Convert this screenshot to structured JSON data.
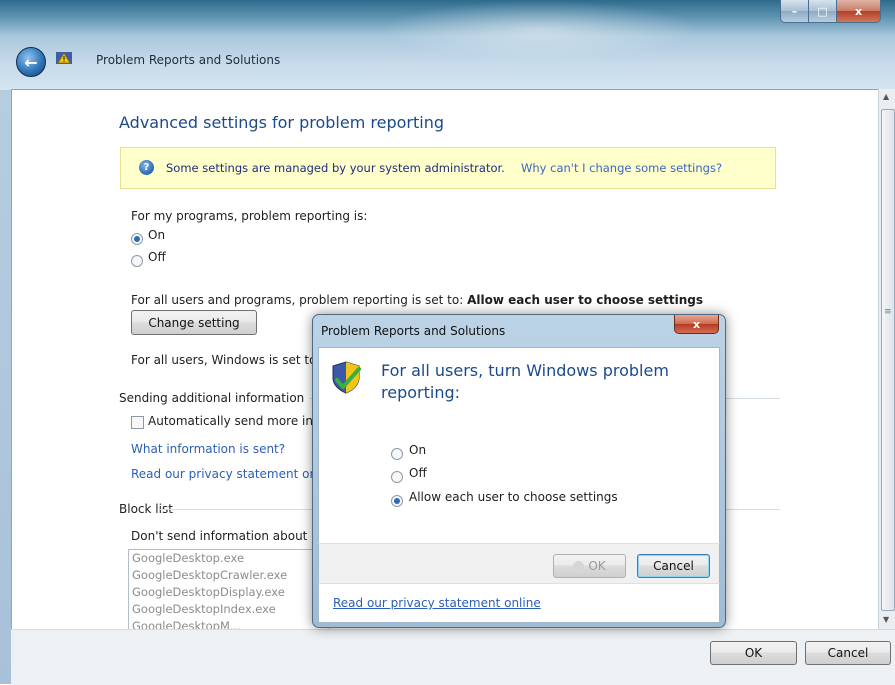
{
  "window": {
    "title": "Problem Reports and Solutions",
    "caption_buttons": {
      "minimize": "–",
      "maximize": "□",
      "close": "x"
    }
  },
  "page": {
    "heading": "Advanced settings for problem reporting",
    "notice": {
      "text": "Some settings are managed by your system administrator.",
      "link": "Why can't I change some settings?"
    },
    "my_programs": {
      "label": "For my programs, problem reporting is:",
      "options": [
        "On",
        "Off"
      ],
      "selected": "On"
    },
    "all_users_programs": {
      "prefix": "For all users and programs, problem reporting is set to:",
      "value": "Allow each user to choose settings",
      "button": "Change setting"
    },
    "all_users_windows": "For all users, Windows is set to",
    "sending_additional_info": {
      "heading": "Sending additional information",
      "checkbox_label": "Automatically send more in",
      "link_what": "What information is sent?",
      "link_privacy": "Read our privacy statement on"
    },
    "block_list": {
      "heading": "Block list",
      "label": "Don't send information about",
      "items": [
        "GoogleDesktop.exe",
        "GoogleDesktopCrawler.exe",
        "GoogleDesktopDisplay.exe",
        "GoogleDesktopIndex.exe",
        "GoogleDesktopM..."
      ]
    },
    "footer": {
      "ok": "OK",
      "cancel": "Cancel"
    }
  },
  "dialog": {
    "title": "Problem Reports and Solutions",
    "close": "x",
    "heading": "For all users, turn Windows problem reporting:",
    "options": [
      "On",
      "Off",
      "Allow each user to choose settings"
    ],
    "selected": "Allow each user to choose settings",
    "ok": "OK",
    "cancel": "Cancel",
    "privacy_link": "Read our privacy statement online"
  },
  "icons": {
    "back": "back-arrow-icon",
    "app": "problem-reports-icon",
    "help": "question-icon",
    "shield": "shield-checkmark-icon"
  }
}
